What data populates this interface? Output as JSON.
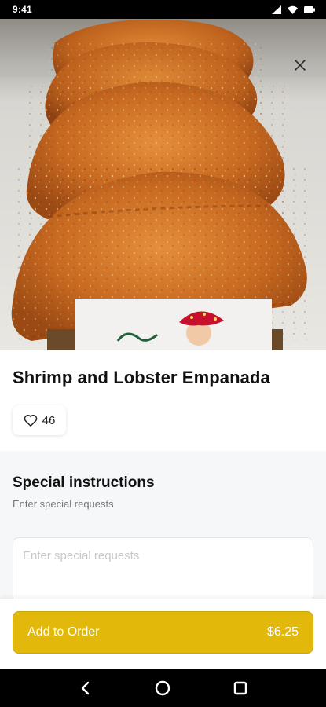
{
  "status_bar": {
    "time": "9:41",
    "icons": [
      "signal-icon",
      "wifi-icon",
      "battery-icon"
    ]
  },
  "hero": {
    "image_subject": "fried empanadas",
    "close_icon": "close-icon"
  },
  "item": {
    "title": "Shrimp and Lobster Empanada",
    "likes": "46",
    "like_icon": "heart-outline-icon"
  },
  "special_instructions": {
    "title": "Special instructions",
    "subtitle": "Enter special requests",
    "placeholder": "Enter special requests",
    "value": ""
  },
  "action": {
    "label": "Add to Order",
    "price": "$6.25",
    "color": "#e2b90b"
  },
  "nav": {
    "back_icon": "back-icon",
    "home_icon": "home-icon",
    "recents_icon": "recents-icon"
  }
}
